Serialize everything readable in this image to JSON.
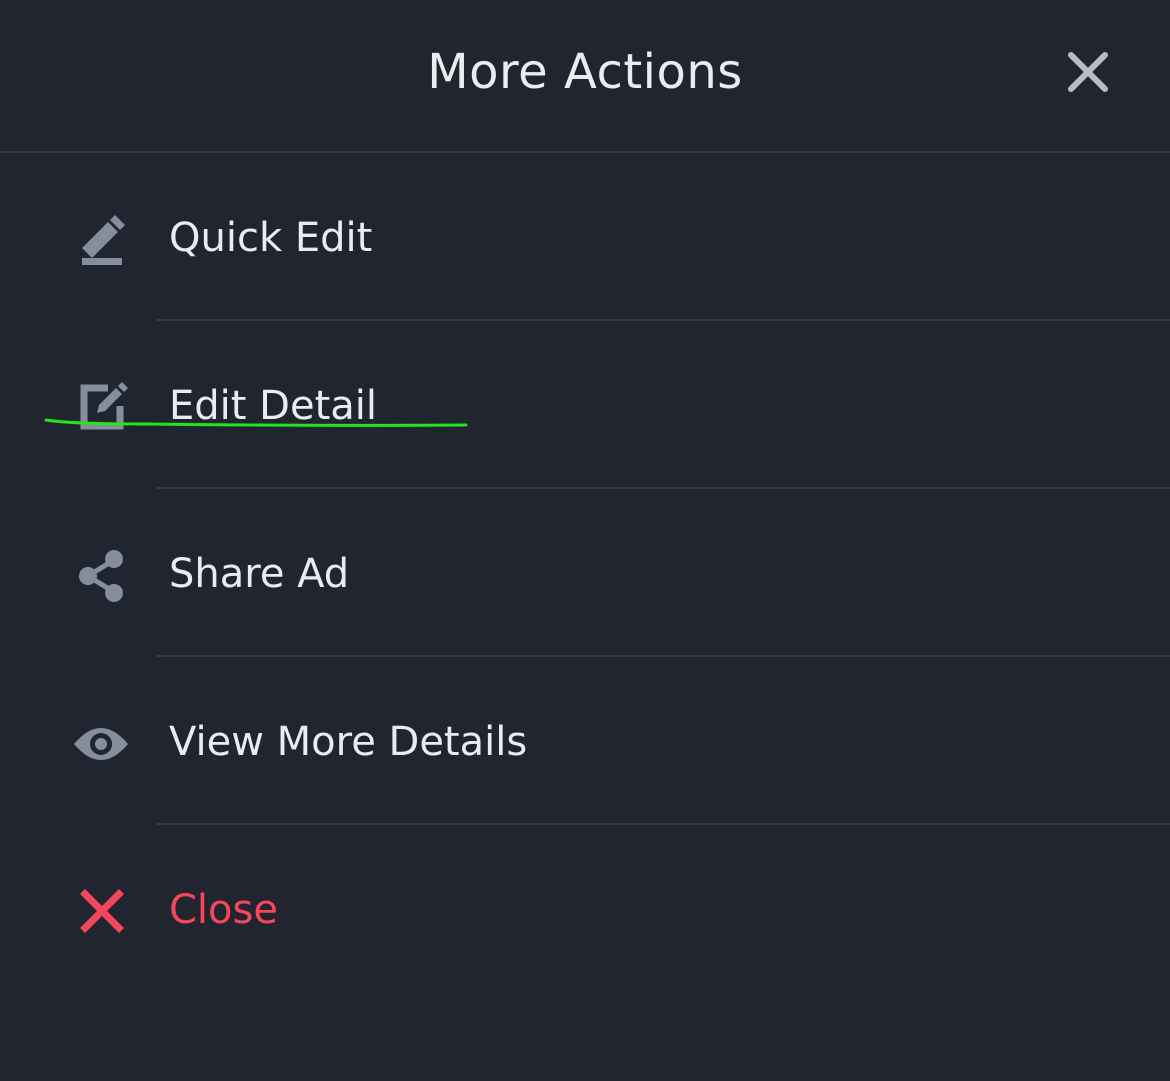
{
  "header": {
    "title": "More Actions",
    "close_icon": "close-icon"
  },
  "menu": {
    "items": [
      {
        "label": "Quick Edit",
        "icon": "quick-edit-icon"
      },
      {
        "label": "Edit Detail",
        "icon": "edit-detail-icon"
      },
      {
        "label": "Share Ad",
        "icon": "share-icon"
      },
      {
        "label": "View More Details",
        "icon": "eye-icon"
      },
      {
        "label": "Close",
        "icon": "close-red-icon"
      }
    ]
  },
  "colors": {
    "background": "#20252f",
    "divider": "#343a45",
    "text": "#eaecef",
    "icon": "#848e9c",
    "danger": "#f6465d",
    "annotation": "#22e51c"
  }
}
